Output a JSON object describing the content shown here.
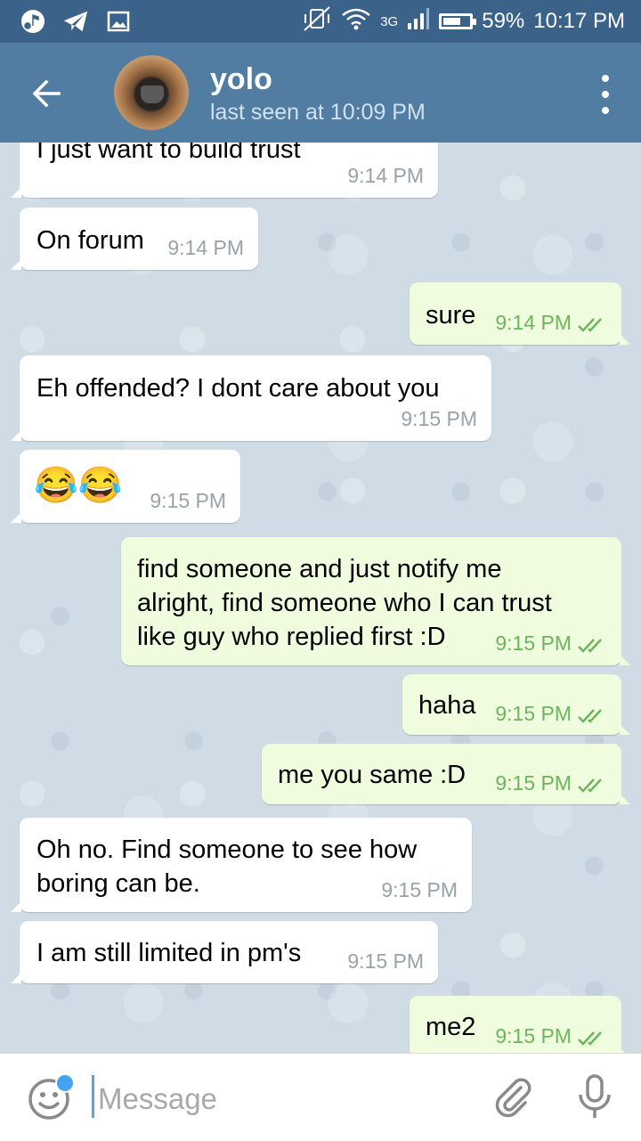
{
  "status_bar": {
    "network": "3G",
    "battery": "59%",
    "time": "10:17 PM",
    "battery_level": 0.59
  },
  "header": {
    "title": "yolo",
    "status": "last seen at 10:09 PM"
  },
  "messages": [
    {
      "direction": "in",
      "text": "I just want to build trust",
      "time": "9:14 PM"
    },
    {
      "direction": "in",
      "text": "On forum",
      "time": "9:14 PM"
    },
    {
      "direction": "out",
      "text": "sure",
      "time": "9:14 PM",
      "read": true
    },
    {
      "direction": "in",
      "text": "Eh offended? I dont care about you",
      "time": "9:15 PM"
    },
    {
      "direction": "in",
      "text": "😂😂",
      "time": "9:15 PM"
    },
    {
      "direction": "out",
      "text": "find someone and just notify me\nalright, find someone who I can trust\nlike guy who replied first :D",
      "time": "9:15 PM",
      "read": true
    },
    {
      "direction": "out",
      "text": "haha",
      "time": "9:15 PM",
      "read": true
    },
    {
      "direction": "out",
      "text": "me you same :D",
      "time": "9:15 PM",
      "read": true
    },
    {
      "direction": "in",
      "text": "Oh no. Find someone to see how\nboring can be.",
      "time": "9:15 PM"
    },
    {
      "direction": "in",
      "text": "I am still limited in pm's",
      "time": "9:15 PM"
    },
    {
      "direction": "out",
      "text": "me2",
      "time": "9:15 PM",
      "read": true
    }
  ],
  "input": {
    "placeholder": "Message"
  },
  "colors": {
    "header": "#517da2",
    "status_bar": "#3b6288",
    "outgoing_bubble": "#effdde",
    "incoming_bubble": "#ffffff",
    "outgoing_time": "#6cb55c",
    "incoming_time": "#97a2ab"
  },
  "icons": {
    "back": "arrow-left-icon",
    "menu": "more-vertical-icon",
    "emoji": "smiley-icon",
    "attach": "paperclip-icon",
    "mic": "microphone-icon"
  }
}
